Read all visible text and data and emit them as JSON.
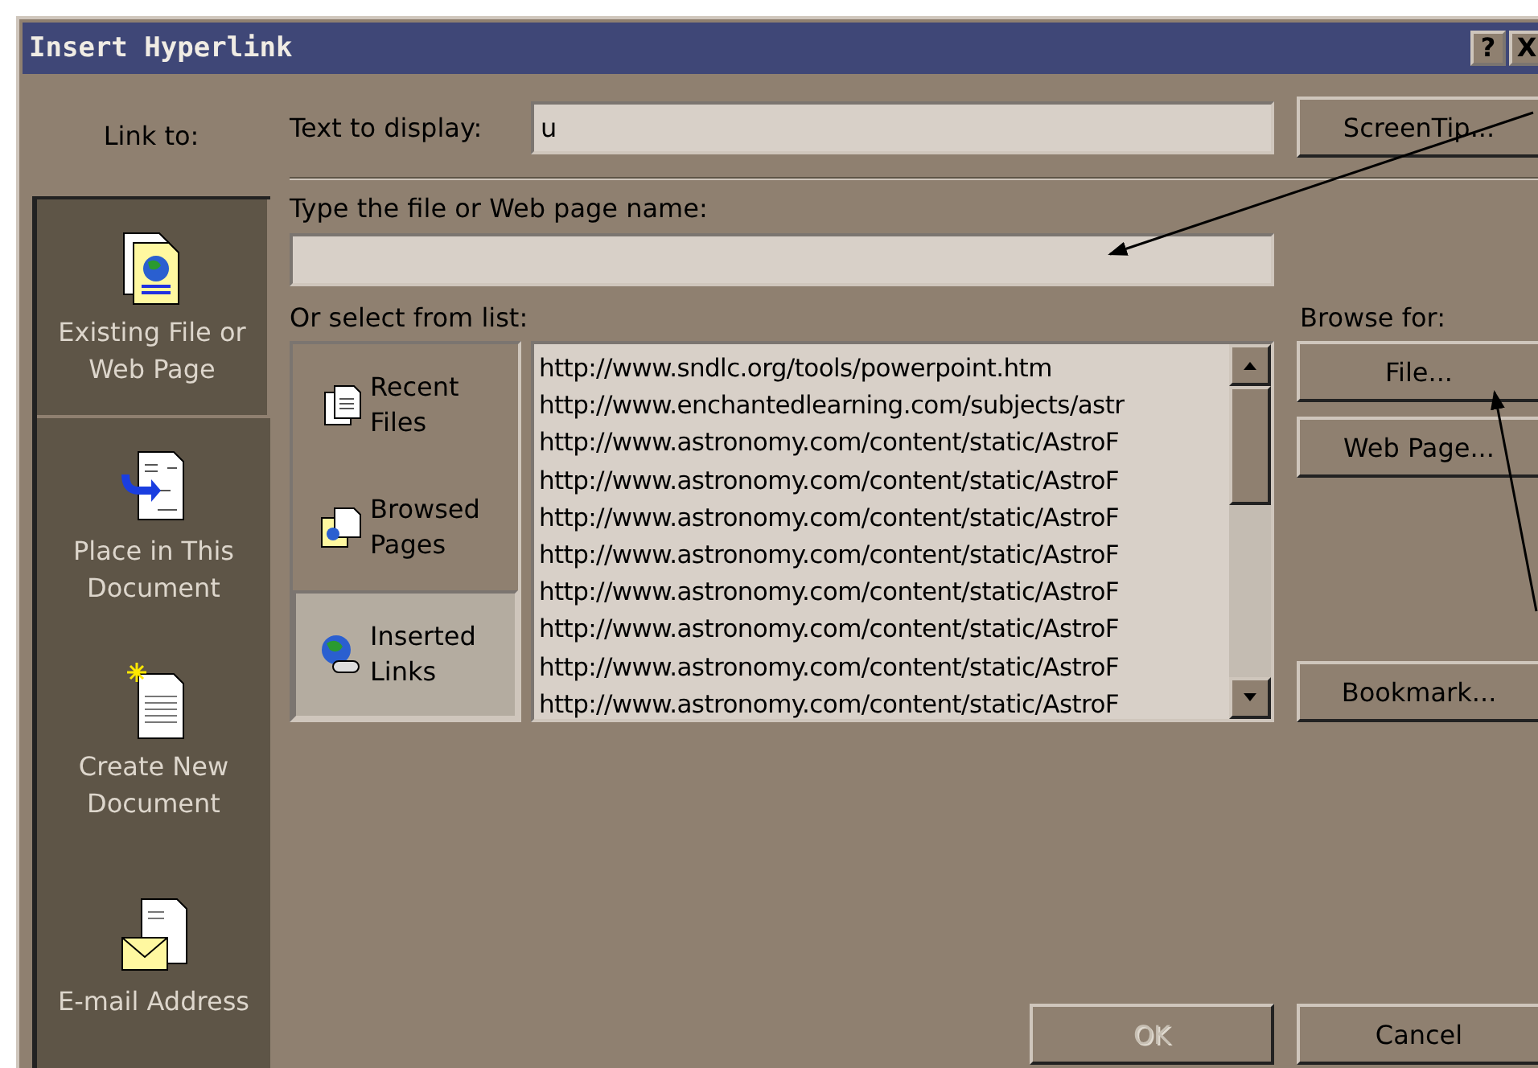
{
  "window": {
    "title": "Insert Hyperlink",
    "controls": [
      "?",
      "X"
    ]
  },
  "link_to": {
    "label": "Link to:",
    "items": [
      {
        "label": "Existing File or Web Page",
        "selected": true,
        "kind": "globe"
      },
      {
        "label": "Place in This Document",
        "selected": false,
        "kind": "place"
      },
      {
        "label": "Create New Document",
        "selected": false,
        "kind": "new"
      },
      {
        "label": "E-mail Address",
        "selected": false,
        "kind": "mail"
      }
    ]
  },
  "text_to_display": {
    "label": "Text to display:",
    "value": "u"
  },
  "screentip_button": "ScreenTip...",
  "file_name": {
    "label": "Type the file or Web page name:"
  },
  "select_from_list": {
    "label": "Or select from list:",
    "sources": [
      {
        "label": "Recent Files",
        "selected": false,
        "kind": "docs"
      },
      {
        "label": "Browsed Pages",
        "selected": false,
        "kind": "pages"
      },
      {
        "label": "Inserted Links",
        "selected": true,
        "kind": "links"
      }
    ],
    "urls": [
      "http://www.sndlc.org/tools/powerpoint.htm",
      "http://www.enchantedlearning.com/subjects/astr",
      "http://www.astronomy.com/content/static/AstroF",
      "http://www.astronomy.com/content/static/AstroF",
      "http://www.astronomy.com/content/static/AstroF",
      "http://www.astronomy.com/content/static/AstroF",
      "http://www.astronomy.com/content/static/AstroF",
      "http://www.astronomy.com/content/static/AstroF",
      "http://www.astronomy.com/content/static/AstroF",
      "http://www.astronomy.com/content/static/AstroF"
    ]
  },
  "browse_for": {
    "label": "Browse for:",
    "buttons": [
      "File...",
      "Web Page..."
    ],
    "bookmark": "Bookmark..."
  },
  "footer_buttons": [
    {
      "label": "OK",
      "disabled": true
    },
    {
      "label": "Cancel",
      "disabled": false
    }
  ]
}
